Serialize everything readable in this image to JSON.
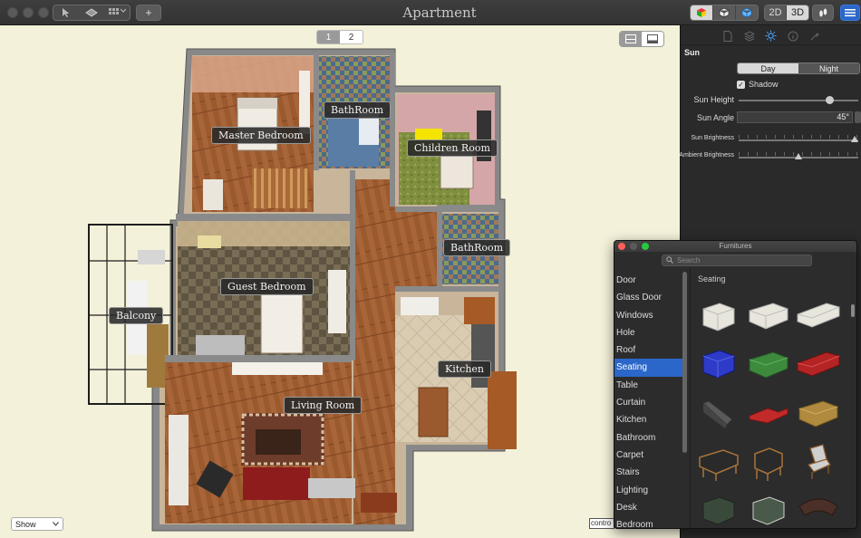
{
  "window": {
    "title": "Apartment"
  },
  "toolbar": {
    "add_label": "+",
    "view_2d": "2D",
    "view_3d": "3D",
    "active_view": "3D"
  },
  "canvas": {
    "pages": [
      "1",
      "2"
    ],
    "active_page": "1",
    "show_select": "Show",
    "control_tag": "contro"
  },
  "rooms": [
    {
      "label": "Master Bedroom"
    },
    {
      "label": "BathRoom"
    },
    {
      "label": "Children Room"
    },
    {
      "label": "BathRoom"
    },
    {
      "label": "Guest Bedroom"
    },
    {
      "label": "Balcony"
    },
    {
      "label": "Kitchen"
    },
    {
      "label": "Living Room"
    }
  ],
  "inspector": {
    "section": "Sun",
    "day_label": "Day",
    "night_label": "Night",
    "active_mode": "Day",
    "shadow_label": "Shadow",
    "shadow_checked": true,
    "sun_height_label": "Sun Height",
    "sun_height_value": 0.78,
    "sun_angle_label": "Sun Angle",
    "sun_angle_value": "45°",
    "sun_brightness_label": "Sun Brightness",
    "sun_brightness_value": 1.0,
    "ambient_brightness_label": "Ambient Brightness",
    "ambient_brightness_value": 0.5
  },
  "furnitures": {
    "title": "Furnitures",
    "search_placeholder": "Search",
    "categories": [
      "Door",
      "Glass Door",
      "Windows",
      "Hole",
      "Roof",
      "Seating",
      "Table",
      "Curtain",
      "Kitchen",
      "Bathroom",
      "Carpet",
      "Stairs",
      "Lighting",
      "Desk",
      "Bedroom"
    ],
    "selected": "Seating",
    "group_label": "Seating"
  },
  "colors": {
    "accent": "#2a67c9",
    "canvas_bg": "#f4f1da",
    "wall": "#8a8a8a",
    "wood_floor": "#9b5a2e",
    "highlight_blue": "#4da0ff"
  }
}
